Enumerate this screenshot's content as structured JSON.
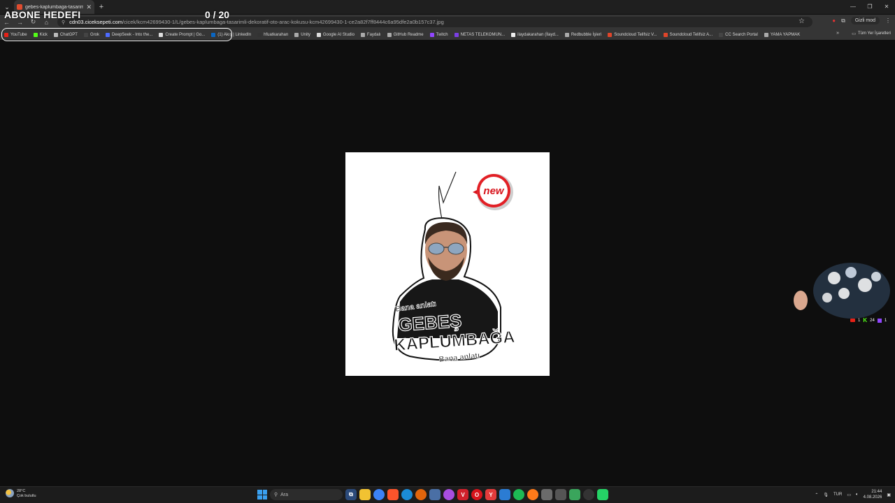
{
  "overlay": {
    "title": "ABONE HEDEFI",
    "count": "0 / 20"
  },
  "tab": {
    "title": "gebes-kaplumbaga-tasarimli-o"
  },
  "omnibox": {
    "domain": "cdn03.ciceksepeti.com",
    "path": "/cicek/kcm42699430-1/L/gebes-kaplumbaga-tasarimli-dekoratif-oto-arac-kokusu-kcm42699430-1-ce2a82f7ff8444c6a95dfe2a0b157c37.jpg"
  },
  "incognito": "Gizli mod",
  "bookmarks": [
    {
      "label": "YouTube",
      "color": "#e62117"
    },
    {
      "label": "Kick",
      "color": "#53fc18"
    },
    {
      "label": "ChatGPT",
      "color": "#bbbbbb"
    },
    {
      "label": "Grok",
      "color": "#444444"
    },
    {
      "label": "DeepSeek - Into the...",
      "color": "#4d6bfe"
    },
    {
      "label": "Create Prompt | Go...",
      "color": "#dddddd"
    },
    {
      "label": "(1) Akış | LinkedIn",
      "color": "#0a66c2"
    },
    {
      "label": "hfuatkarahan",
      "color": "#333333"
    },
    {
      "label": "Unity",
      "color": "#aaaaaa"
    },
    {
      "label": "Google AI Studio",
      "color": "#dddddd"
    },
    {
      "label": "Faydalı",
      "color": "#aaaaaa"
    },
    {
      "label": "GitHub Readme",
      "color": "#aaaaaa"
    },
    {
      "label": "Twitch",
      "color": "#9146ff"
    },
    {
      "label": "NETAS TELEKOMUN...",
      "color": "#7b3fe4"
    },
    {
      "label": "ilaydakarahan (İlayd...",
      "color": "#eeeeee"
    },
    {
      "label": "Redbubble İşleri",
      "color": "#aaaaaa"
    },
    {
      "label": "Soundcloud Telifsiz V...",
      "color": "#e0452a"
    },
    {
      "label": "Soundcloud Telifsiz A...",
      "color": "#e0452a"
    },
    {
      "label": "CC Search Portal",
      "color": "#444444"
    },
    {
      "label": "YAMA YAPMAK",
      "color": "#aaaaaa"
    }
  ],
  "bookmarks_all": "Tüm Yer İşaretleri",
  "image": {
    "badge": "new",
    "line1": "Bana anlatı",
    "line2": "GEBEŞ",
    "line3": "KAPLUMBAĞA",
    "line4": "Bana anlatı"
  },
  "webcam_stats": {
    "youtube": "1",
    "kick": "24",
    "twitch": "1"
  },
  "taskbar": {
    "weather_temp": "28°C",
    "weather_desc": "Çok bulutlu",
    "search_placeholder": "Ara",
    "lang": "TUR",
    "time": "21:44",
    "date": "4.08.2026"
  }
}
